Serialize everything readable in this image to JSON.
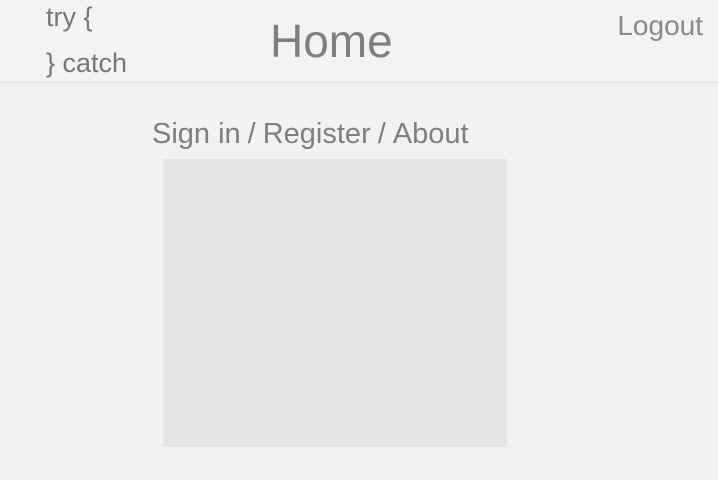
{
  "header": {
    "logo_line1": "try {",
    "logo_line2": "} catch",
    "title": "Home",
    "logout_label": "Logout"
  },
  "nav": {
    "sign_in": "Sign in",
    "register": "Register",
    "about": "About",
    "separator": "/"
  },
  "colors": {
    "background": "#f2f2f2",
    "text": "#8a8a8a",
    "content_box": "#e5e5e7"
  }
}
